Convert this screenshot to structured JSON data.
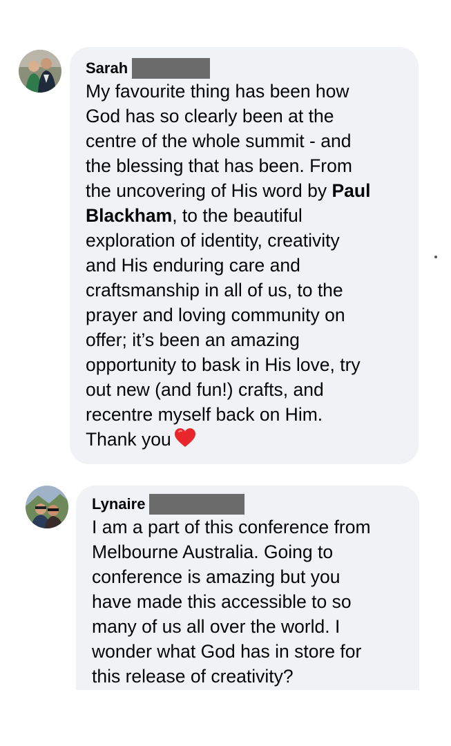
{
  "comments": [
    {
      "author": "Sarah",
      "lines": [
        "My favourite thing has been how",
        "God has so clearly been at the",
        "centre of the whole summit - and",
        "the blessing that has been. From",
        "the uncovering of His word by ",
        "Paul",
        "Blackham",
        ", to the beautiful",
        "exploration of identity, creativity",
        "and His enduring care and",
        "craftsmanship in all of us, to the",
        "prayer and loving community on",
        "offer; it’s been an amazing",
        "opportunity to bask in His love, try",
        "out new (and fun!) crafts, and",
        "recentre myself back on Him.",
        "Thank you"
      ],
      "reaction_emoji": "red-heart-icon"
    },
    {
      "author": "Lynaire",
      "lines": [
        "I am a part of this conference from",
        "Melbourne Australia. Going to",
        "conference is amazing but you",
        "have made this accessible to so",
        "many of us all over the world. I",
        "wonder what God has in store for",
        "this release of creativity?"
      ]
    }
  ],
  "colors": {
    "bubble": "#f0f2f5",
    "text": "#050505",
    "redaction": "#6b6b6b",
    "heart": "#e8262c"
  }
}
